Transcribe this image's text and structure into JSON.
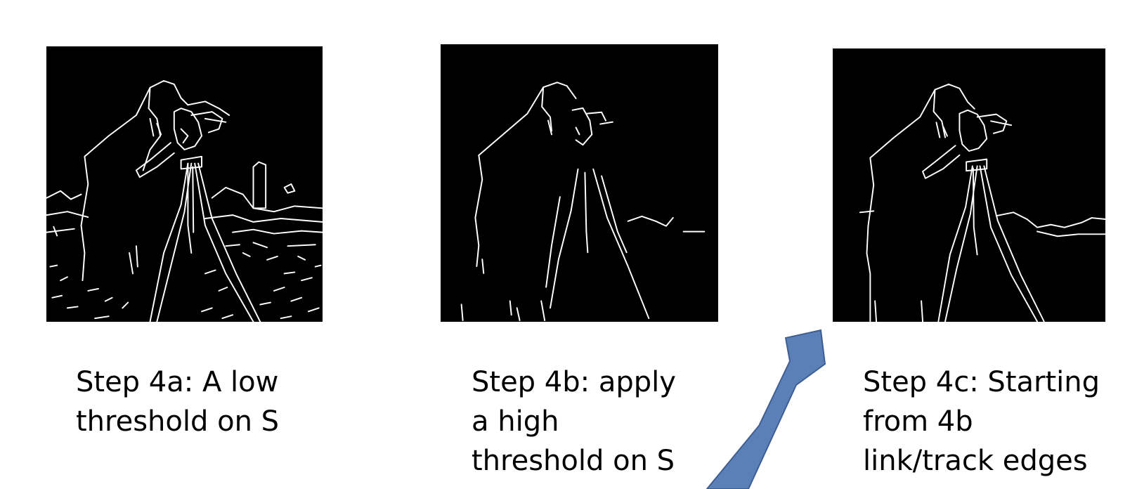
{
  "panels": [
    {
      "id": "step-4a",
      "image": "edge-map-low-threshold",
      "caption_lines": [
        "Step 4a: A low",
        "threshold on S"
      ]
    },
    {
      "id": "step-4b",
      "image": "edge-map-high-threshold",
      "caption_lines": [
        "Step 4b: apply",
        "a high",
        "threshold on S"
      ]
    },
    {
      "id": "step-4c",
      "image": "edge-map-linked-edges",
      "caption_lines": [
        "Step 4c: Starting",
        "from 4b",
        "link/track edges"
      ]
    }
  ],
  "arrow": {
    "icon": "up-right-arrow-icon",
    "fill": "#5b7fb7",
    "stroke": "#3e5e94"
  },
  "colors": {
    "background": "#ffffff",
    "panel": "#000000",
    "edges": "#ffffff",
    "text": "#000000"
  }
}
